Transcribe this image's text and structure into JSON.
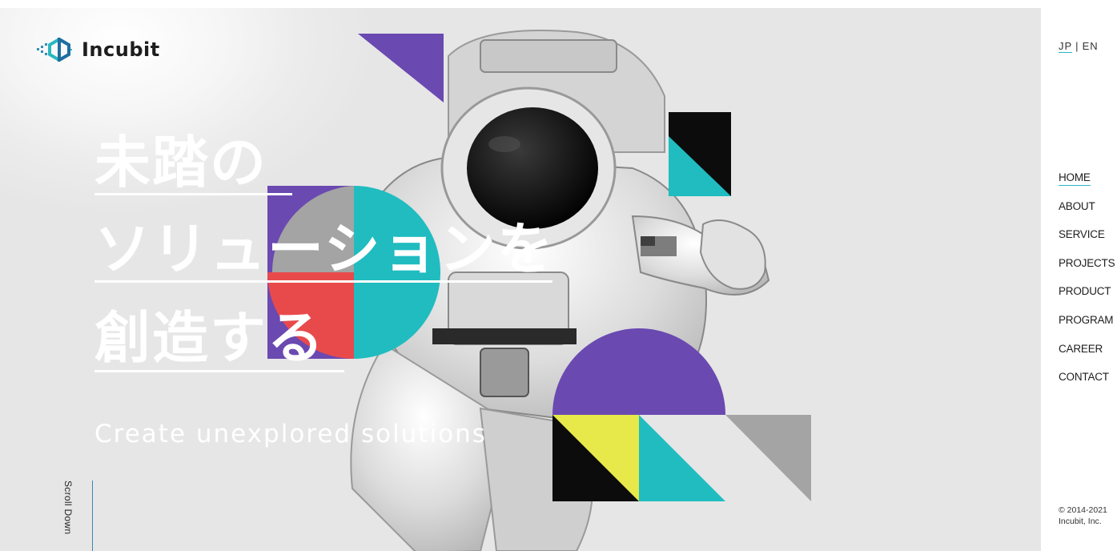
{
  "brand": {
    "name": "Incubit"
  },
  "language": {
    "jp": "JP",
    "separator": "|",
    "en": "EN"
  },
  "hero": {
    "headline": [
      "未踏の",
      "ソリューションを",
      "創造する"
    ],
    "subtitle": "Create unexplored solutions",
    "scroll_label": "Scroll Down"
  },
  "nav": [
    {
      "label": "HOME",
      "active": true
    },
    {
      "label": "ABOUT"
    },
    {
      "label": "SERVICE"
    },
    {
      "label": "PROJECTS"
    },
    {
      "label": "PRODUCT"
    },
    {
      "label": "PROGRAM"
    },
    {
      "label": "CAREER"
    },
    {
      "label": "CONTACT"
    }
  ],
  "footer": {
    "copyright_line1": "© 2014-2021",
    "copyright_line2": "Incubit, Inc."
  },
  "colors": {
    "purple": "#6a49b1",
    "teal": "#20bcc0",
    "red": "#e84a4c",
    "yellow": "#e7e84a",
    "black": "#0c0c0c",
    "gray": "#a4a4a4",
    "accent": "#2ab7c0"
  }
}
